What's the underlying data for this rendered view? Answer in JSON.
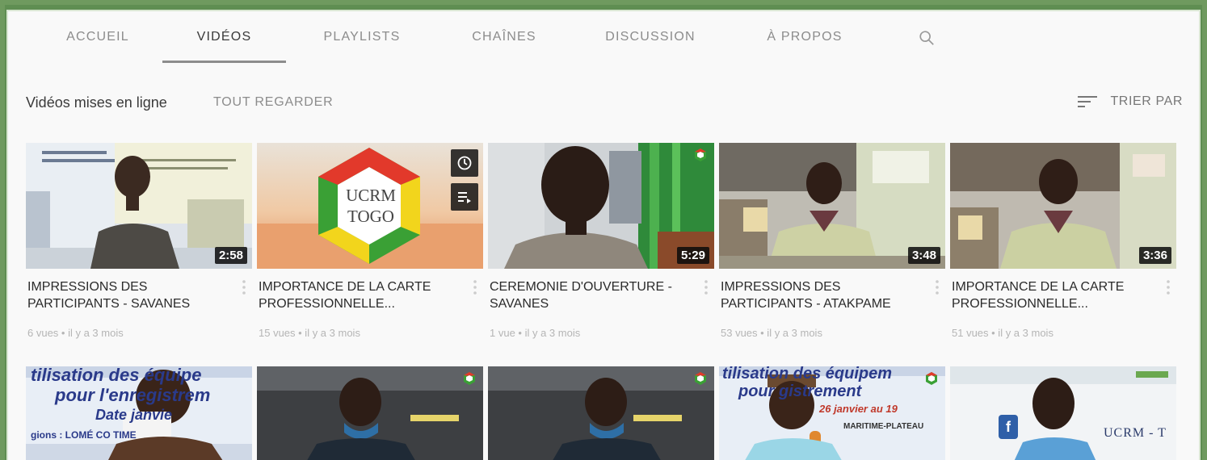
{
  "tabs": [
    {
      "label": "ACCUEIL",
      "active": false
    },
    {
      "label": "VIDÉOS",
      "active": true
    },
    {
      "label": "PLAYLISTS",
      "active": false
    },
    {
      "label": "CHAÎNES",
      "active": false
    },
    {
      "label": "DISCUSSION",
      "active": false
    },
    {
      "label": "À PROPOS",
      "active": false
    }
  ],
  "section": {
    "title": "Vidéos mises en ligne",
    "see_all": "TOUT REGARDER",
    "sort_label": "TRIER PAR"
  },
  "videos": [
    {
      "title_line1": "IMPRESSIONS DES",
      "title_line2": "PARTICIPANTS - SAVANES",
      "duration": "2:58",
      "meta": "6 vues • il y a 3 mois"
    },
    {
      "title_line1": "IMPORTANCE DE LA CARTE",
      "title_line2": "PROFESSIONNELLE...",
      "duration": "",
      "meta": "15 vues • il y a 3 mois",
      "logo_text_1": "UCRM",
      "logo_text_2": "TOGO"
    },
    {
      "title_line1": "CEREMONIE D'OUVERTURE -",
      "title_line2": "SAVANES",
      "duration": "5:29",
      "meta": "1 vue • il y a 3 mois"
    },
    {
      "title_line1": "IMPRESSIONS DES",
      "title_line2": "PARTICIPANTS - ATAKPAME",
      "duration": "3:48",
      "meta": "53 vues • il y a 3 mois"
    },
    {
      "title_line1": "IMPORTANCE DE LA CARTE",
      "title_line2": "PROFESSIONNELLE...",
      "duration": "3:36",
      "meta": "51 vues • il y a 3 mois"
    }
  ],
  "row2_texts": {
    "banner_line1": "tilisation des équipe",
    "banner_line2": "pour l'enregistrem",
    "banner_line3": "Date   janvie",
    "banner_line4": "gions : LOMÉ CO        TIME",
    "banner4_line1": "tilisation des équipem",
    "banner4_line2": "pour    gistrement",
    "banner4_line3": "26 janvier au 19",
    "banner4_line4": "MARITIME-PLATEAU",
    "banner5_text": "UCRM - T"
  },
  "colors": {
    "page_bg": "#f9f9f9",
    "outer_frame": "#6f9a5f",
    "title_text": "#2b2b2b",
    "muted_text": "#8c8c8c",
    "duration_bg": "#0a0a0a"
  },
  "icons": [
    "search-icon",
    "sort-icon",
    "more-vert-icon",
    "clock-icon",
    "playlist-add-icon"
  ]
}
